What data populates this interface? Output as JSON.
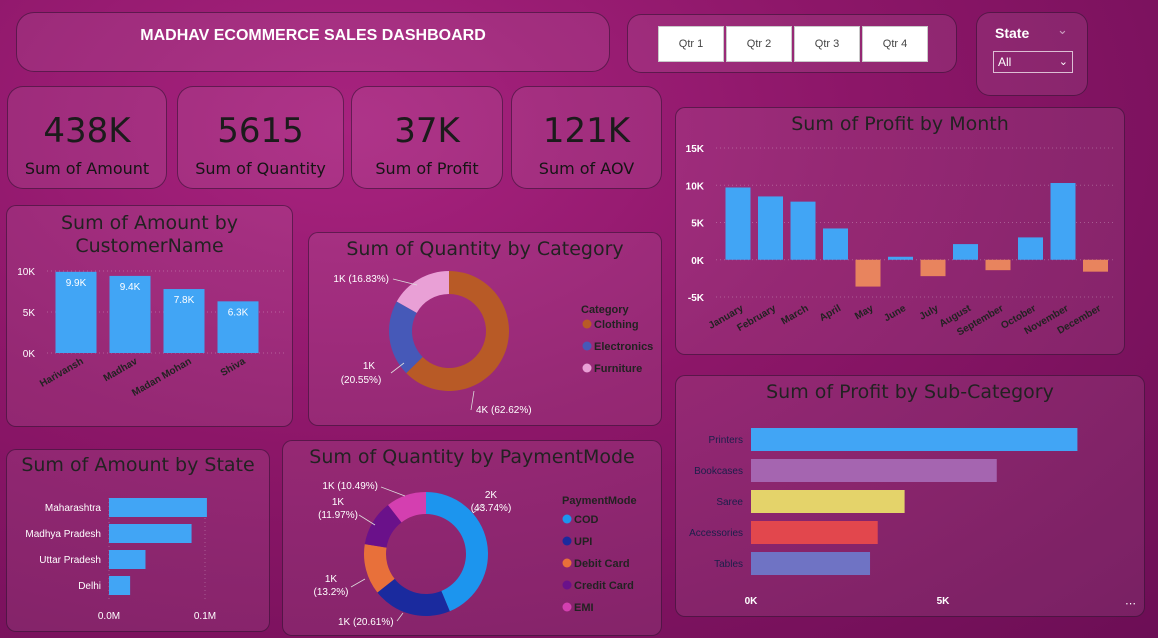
{
  "header": {
    "title": "MADHAV ECOMMERCE SALES DASHBOARD"
  },
  "quarters": [
    "Qtr 1",
    "Qtr 2",
    "Qtr 3",
    "Qtr 4"
  ],
  "state_filter": {
    "title": "State",
    "selected": "All"
  },
  "kpis": [
    {
      "value": "438K",
      "label": "Sum of Amount"
    },
    {
      "value": "5615",
      "label": "Sum of Quantity"
    },
    {
      "value": "37K",
      "label": "Sum of Profit"
    },
    {
      "value": "121K",
      "label": "Sum of AOV"
    }
  ],
  "colors": {
    "blue": "#41a5f5",
    "orange": "#e8845e",
    "accent": "#b0267f"
  },
  "chart_data": [
    {
      "id": "amount-by-customer",
      "type": "bar",
      "title": "Sum of Amount by CustomerName",
      "categories": [
        "Harivansh",
        "Madhav",
        "Madan Mohan",
        "Shiva"
      ],
      "values": [
        9900,
        9400,
        7800,
        6300
      ],
      "data_labels": [
        "9.9K",
        "9.4K",
        "7.8K",
        "6.3K"
      ],
      "yticks": [
        "0K",
        "5K",
        "10K"
      ],
      "ylim": [
        0,
        10000
      ],
      "color": "#41a5f5"
    },
    {
      "id": "quantity-by-category",
      "type": "pie",
      "title": "Sum of Quantity by Category",
      "legend_title": "Category",
      "labels": [
        "Clothing",
        "Electronics",
        "Furniture"
      ],
      "values": [
        62.62,
        20.55,
        16.83
      ],
      "data_labels": [
        "4K (62.62%)",
        "1K (20.55%)",
        "1K (16.83%)"
      ],
      "colors": [
        "#b85a26",
        "#4659b8",
        "#e9a0d6"
      ]
    },
    {
      "id": "profit-by-month",
      "type": "bar",
      "title": "Sum of Profit by Month",
      "categories": [
        "January",
        "February",
        "March",
        "April",
        "May",
        "June",
        "July",
        "August",
        "September",
        "October",
        "November",
        "December"
      ],
      "values": [
        9700,
        8500,
        7800,
        4200,
        -3600,
        400,
        -2200,
        2100,
        -1400,
        3000,
        10300,
        -1600
      ],
      "yticks": [
        "-5K",
        "0K",
        "5K",
        "10K",
        "15K"
      ],
      "ylim": [
        -5000,
        15000
      ],
      "pos_color": "#41a5f5",
      "neg_color": "#e8845e"
    },
    {
      "id": "amount-by-state",
      "type": "bar",
      "title": "Sum of Amount by State",
      "categories": [
        "Maharashtra",
        "Madhya Pradesh",
        "Uttar Pradesh",
        "Delhi"
      ],
      "values": [
        0.102,
        0.086,
        0.038,
        0.022
      ],
      "xticks": [
        "0.0M",
        "0.1M"
      ],
      "xlim": [
        0,
        0.1
      ],
      "color": "#41a5f5"
    },
    {
      "id": "quantity-by-payment",
      "type": "pie",
      "title": "Sum of Quantity by PaymentMode",
      "legend_title": "PaymentMode",
      "labels": [
        "COD",
        "UPI",
        "Debit Card",
        "Credit Card",
        "EMI"
      ],
      "values": [
        43.74,
        20.61,
        13.2,
        11.97,
        10.49
      ],
      "data_labels": [
        "2K (43.74%)",
        "1K (20.61%)",
        "1K (13.2%)",
        "1K (11.97%)",
        "1K (10.49%)"
      ],
      "colors": [
        "#1c95ee",
        "#1a2a9e",
        "#e8703a",
        "#6a118a",
        "#d43fb0"
      ]
    },
    {
      "id": "profit-by-subcategory",
      "type": "bar",
      "title": "Sum of Profit by Sub-Category",
      "categories": [
        "Printers",
        "Bookcases",
        "Saree",
        "Accessories",
        "Tables"
      ],
      "values": [
        8500,
        6400,
        4000,
        3300,
        3100
      ],
      "xticks": [
        "0K",
        "5K"
      ],
      "xlim": [
        0,
        10000
      ],
      "colors": [
        "#41a5f5",
        "#a565b0",
        "#e4d36a",
        "#e2474d",
        "#6f73c4"
      ]
    }
  ]
}
